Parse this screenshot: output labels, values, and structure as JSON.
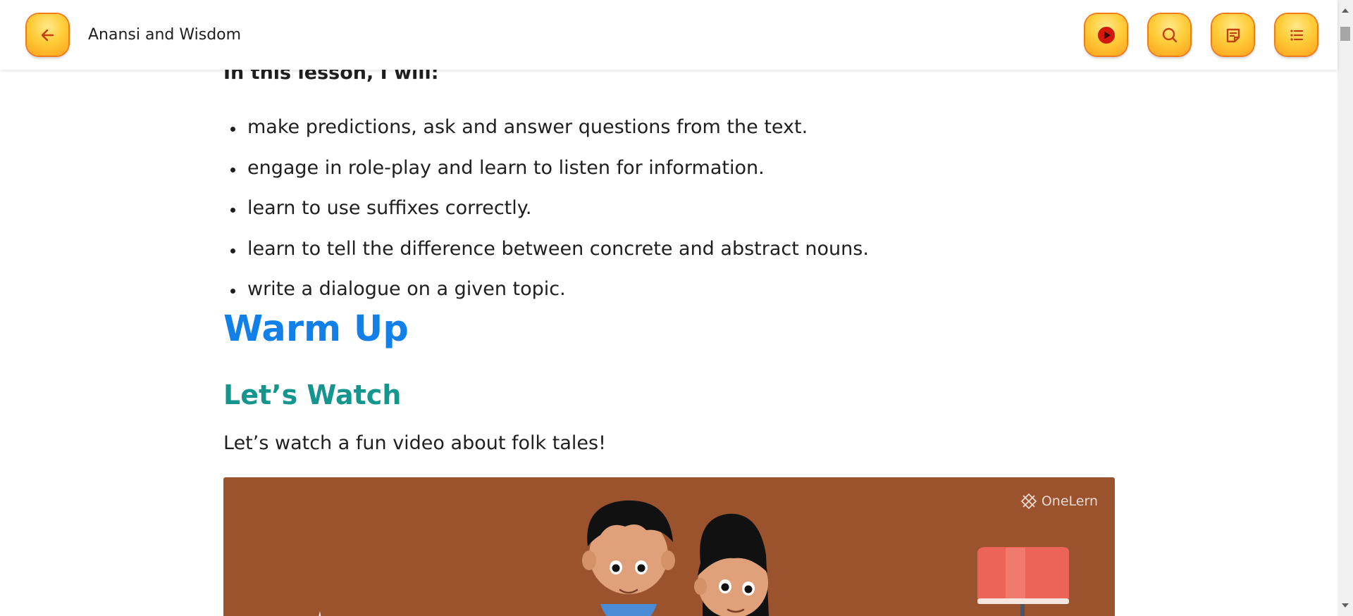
{
  "header": {
    "title": "Anansi and Wisdom",
    "back_icon": "arrow-left-icon",
    "actions": [
      {
        "name": "play-button",
        "icon": "play-circle-icon"
      },
      {
        "name": "search-button",
        "icon": "search-icon"
      },
      {
        "name": "notes-button",
        "icon": "notes-icon"
      },
      {
        "name": "contents-button",
        "icon": "list-icon"
      }
    ]
  },
  "lesson": {
    "lead": "In this lesson, I will:",
    "objectives": [
      "make predictions, ask and answer questions from the text.",
      "engage in role-play and learn to listen for information.",
      "learn to use suffixes correctly.",
      "learn to tell the difference between concrete and abstract nouns.",
      "write a dialogue on a given topic."
    ]
  },
  "warm_up": {
    "heading": "Warm Up",
    "subheading": "Let’s Watch",
    "intro": "Let’s watch a fun video about folk tales!"
  },
  "video": {
    "brand": "OneLern"
  },
  "colors": {
    "button_gradient": "#ffcd3a",
    "button_border": "#f27a1a",
    "heading_blue": "#1180e8",
    "subheading_teal": "#14958e",
    "video_bg": "#9a532d",
    "lamp": "#ec6458"
  }
}
